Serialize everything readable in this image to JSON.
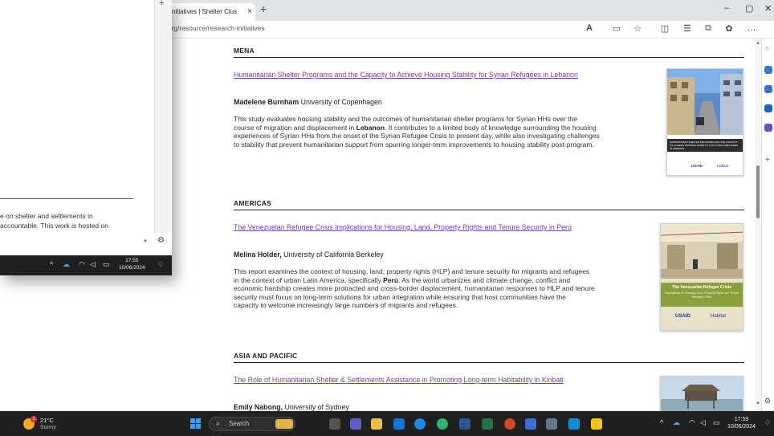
{
  "browser": {
    "tab_title": "h Initiatives | Shelter Clus",
    "tab_close": "×",
    "new_tab": "+",
    "url": "t.org/resource/research-initiatives",
    "window_controls": {
      "minimize": "–",
      "maximize": "▢",
      "close": "✕"
    }
  },
  "sections": [
    {
      "region": "MENA",
      "link": "Humanitarian Shelter Programs and the Capacity to Achieve Housing Stability  for Syrian Refugees in Lebanon",
      "author_name": "Madelene Burnham",
      "author_affil": " University of Copenhagen",
      "desc_lines": [
        "This study evaluates housing stability and the outcomes of humanitarian shelter programs for Syrian HHs over the",
        [
          "course of migration and displacement in ",
          "Lebanon",
          ". It contributes to a limited body of knowledge surrounding the housing"
        ],
        "experiences of Syrian HHs from the onset of the Syrian Refugee Crisis to present day, while also investigating challenges",
        "to stability that prevent humanitarian support from spurring longer-term improvements to housing stability post-program."
      ],
      "thumb_caption": "HUMANITARIAN SHELTER PROGRAMS AND THE CAPACITY TO ACHIEVE HOUSING STABILITY FOR SYRIAN REFUGEES IN LEBANON"
    },
    {
      "region": "AMERICAS",
      "link": "The Venezuelan Refugee Crisis Implications for Housing, Land, Property Rights and Tenure Security in Perú",
      "author_name": "Melina Holder,",
      "author_affil": " University of California Berkeley",
      "desc_lines": [
        "This report examines the context of housing, land, property rights (HLP) and tenure security for migrants and refugees",
        [
          "in the context of urban Latin America, specifically ",
          "Perú",
          ". As the world urbanizes and climate change, conflict and"
        ],
        "economic hardship creates more protracted and cross-border displacement, humanitarian responses to HLP and tenure",
        "security must focus on long-term solutions for urban integration while ensuring that host communities have the",
        "capacity to welcome increasingly large numbers of migrants and refugees."
      ],
      "thumb_title": "The Venezuelan Refugee Crisis",
      "thumb_subtitle": "Implications for Housing, Land, Property Rights and Tenure Security in Perú"
    },
    {
      "region": "ASIA AND PACIFIC",
      "link": "The Role of Humanitarian Shelter & Settlements Assistance in Promoting Long-term Habitability in Kiribati",
      "author_name": "Emily Nabong,",
      "author_affil": " University of Sydney"
    }
  ],
  "logos": {
    "usaid": "USAID",
    "habitat": "Habitat"
  },
  "overlay": {
    "line1": "e on shelter and settlements in",
    "line2": "accountable. This work is hosted on",
    "clock_time": "17:55",
    "clock_date": "10/06/2024"
  },
  "taskbar": {
    "weather_temp": "21°C",
    "weather_cond": "Sunny",
    "weather_badge": "1",
    "search_label": "Search",
    "clock_time": "17:59",
    "clock_date": "10/06/2024"
  },
  "colors": {
    "link": "#6a3fa6",
    "taskbar": "#202020"
  }
}
